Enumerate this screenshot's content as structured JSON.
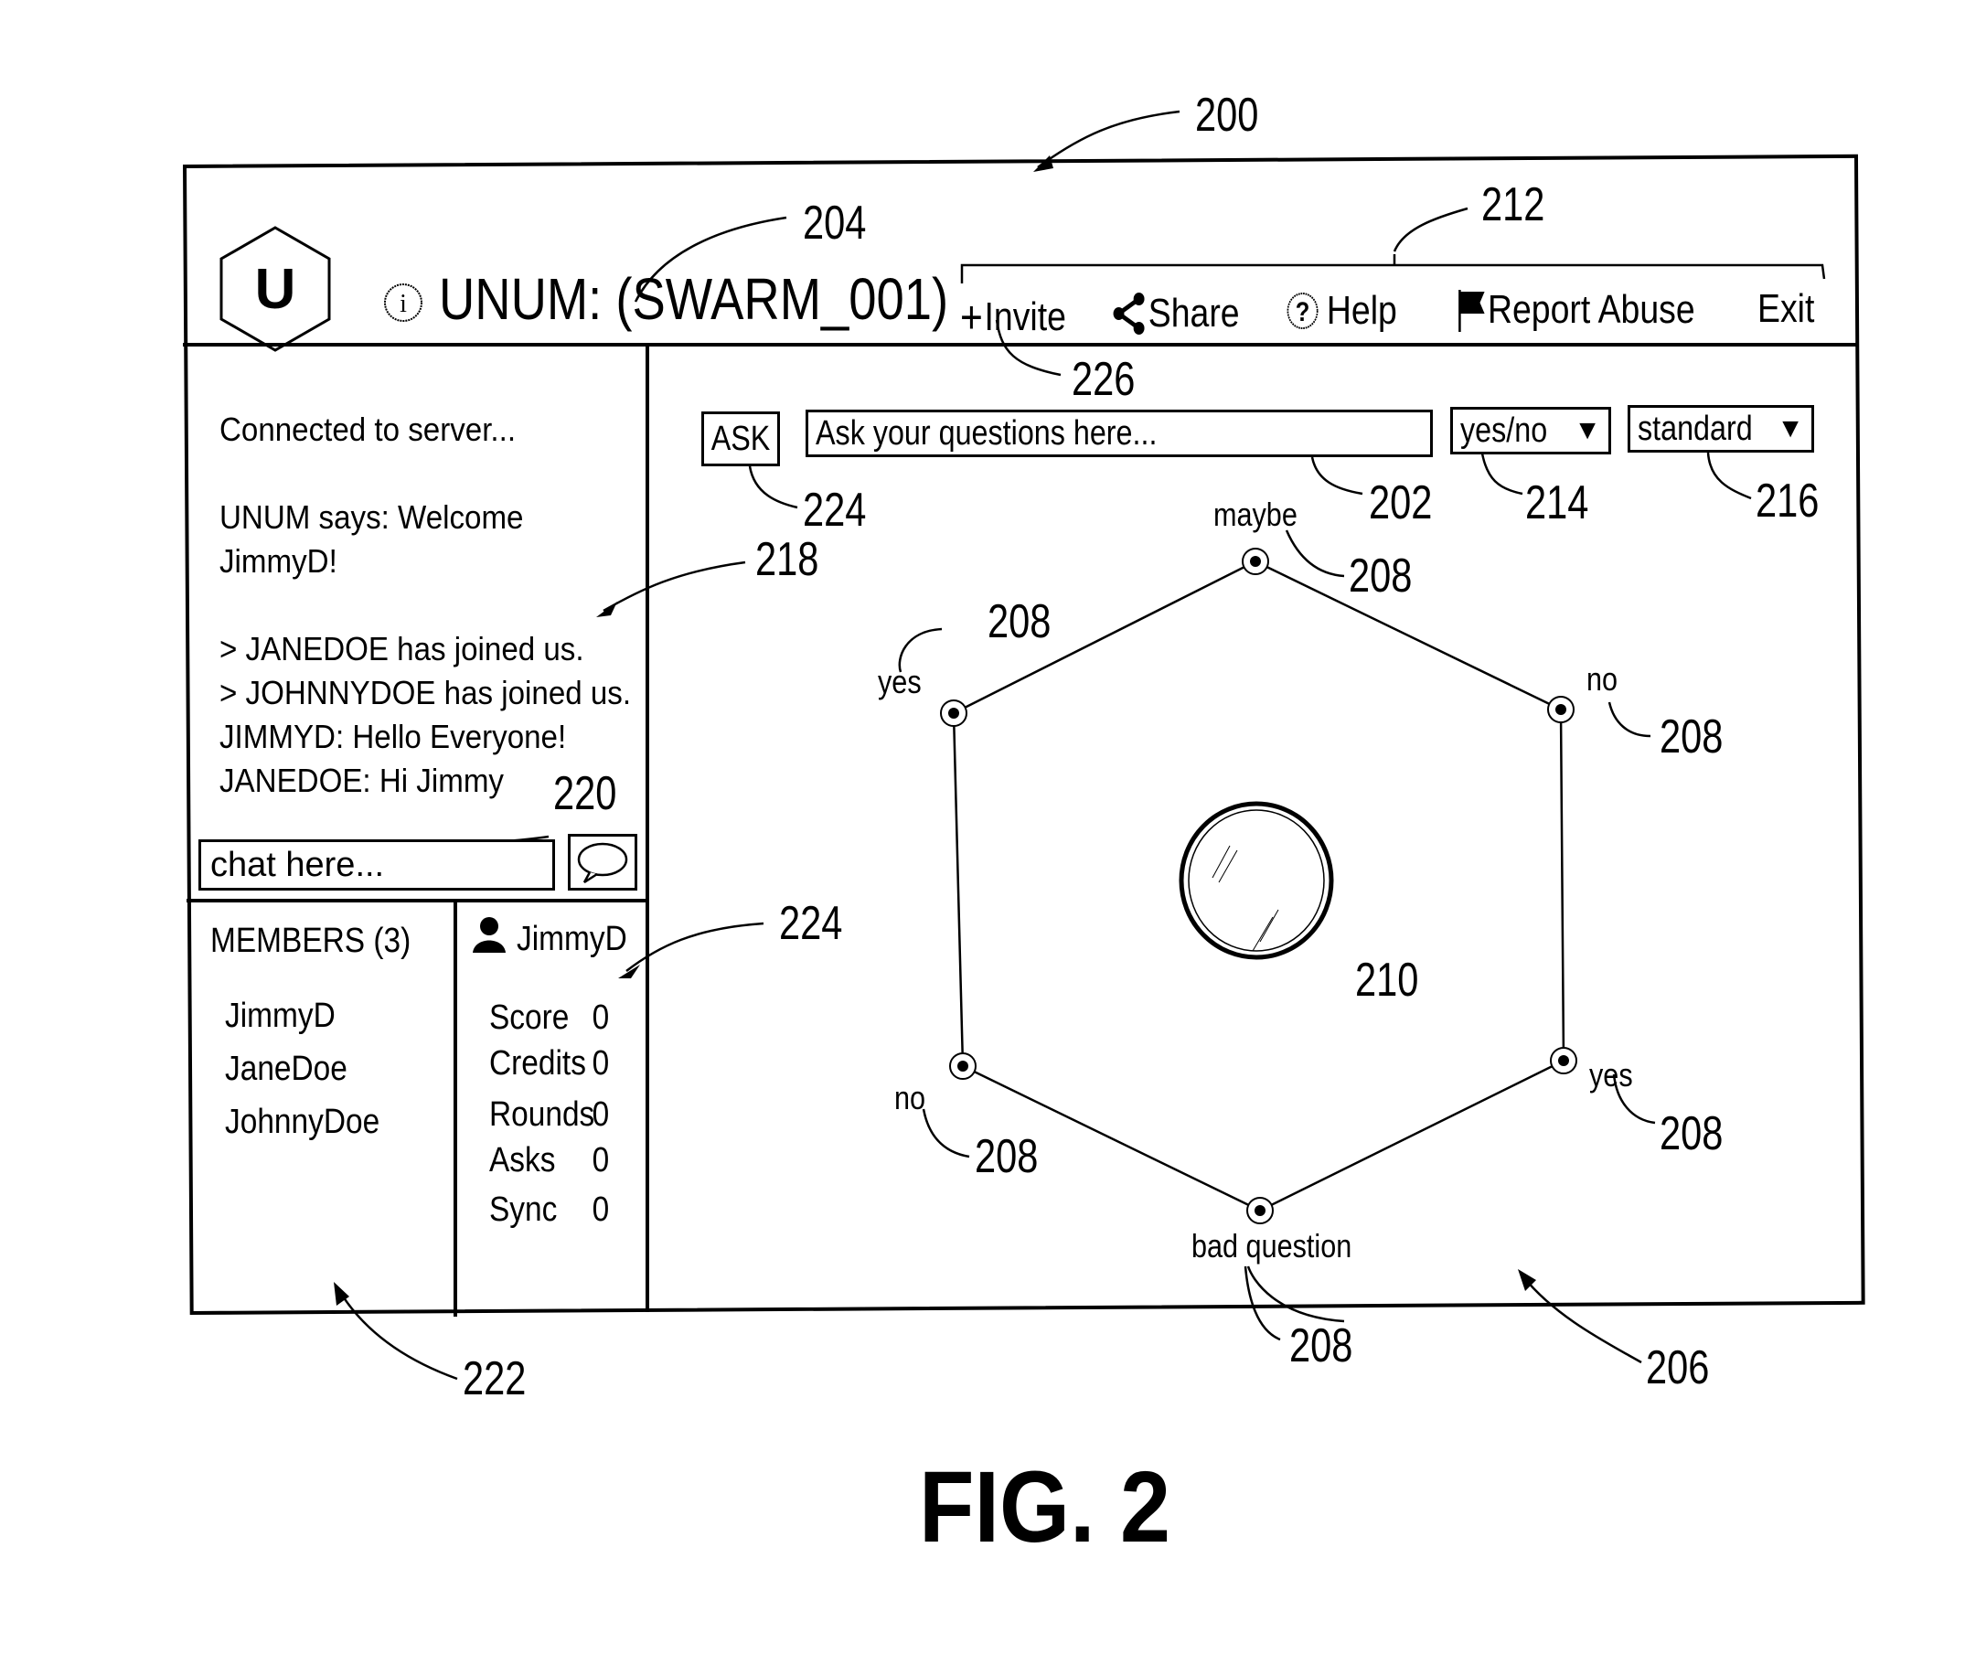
{
  "figure": {
    "label": "FIG. 2",
    "reference_numerals": {
      "window": "200",
      "title": "204",
      "nav_bar": "212",
      "invite": "226",
      "ask_button": "224",
      "question_input": "202",
      "type_select": "214",
      "mode_select": "216",
      "chat_log": "218",
      "chat_input": "220",
      "user_stats": "224",
      "members_panel": "222",
      "board": "206",
      "answer_option": "208",
      "puck": "210"
    }
  },
  "header": {
    "logo_letter": "U",
    "info_icon": "info-icon",
    "title": "UNUM: (SWARM_001)",
    "nav": [
      {
        "icon": "plus-icon",
        "glyph": "+",
        "label": "Invite"
      },
      {
        "icon": "share-icon",
        "glyph": "",
        "label": "Share"
      },
      {
        "icon": "help-icon",
        "glyph": "?",
        "label": "Help"
      },
      {
        "icon": "flag-icon",
        "glyph": "",
        "label": "Report Abuse"
      },
      {
        "icon": "",
        "glyph": "",
        "label": "Exit"
      }
    ]
  },
  "chat": {
    "messages": [
      "Connected to server...",
      "",
      "UNUM says: Welcome",
      "JimmyD!",
      "",
      "> JANEDOE has joined us.",
      "> JOHNNYDOE has joined us.",
      "JIMMYD: Hello Everyone!",
      "JANEDOE: Hi Jimmy"
    ],
    "input_placeholder": "chat here...",
    "send_icon": "speech-bubble-icon"
  },
  "members": {
    "heading": "MEMBERS (3)",
    "list": [
      "JimmyD",
      "JaneDoe",
      "JohnnyDoe"
    ]
  },
  "user": {
    "icon": "user-icon",
    "name": "JimmyD",
    "stats": [
      {
        "label": "Score",
        "value": "0"
      },
      {
        "label": "Credits",
        "value": "0"
      },
      {
        "label": "Rounds",
        "value": "0"
      },
      {
        "label": "Asks",
        "value": "0"
      },
      {
        "label": "Sync",
        "value": "0"
      }
    ]
  },
  "question_bar": {
    "ask_label": "ASK",
    "input_placeholder": "Ask your questions here...",
    "type_select": "yes/no",
    "mode_select": "standard",
    "dropdown_glyph": "▼"
  },
  "board": {
    "options": [
      "maybe",
      "no",
      "yes",
      "bad question",
      "no",
      "yes"
    ]
  }
}
